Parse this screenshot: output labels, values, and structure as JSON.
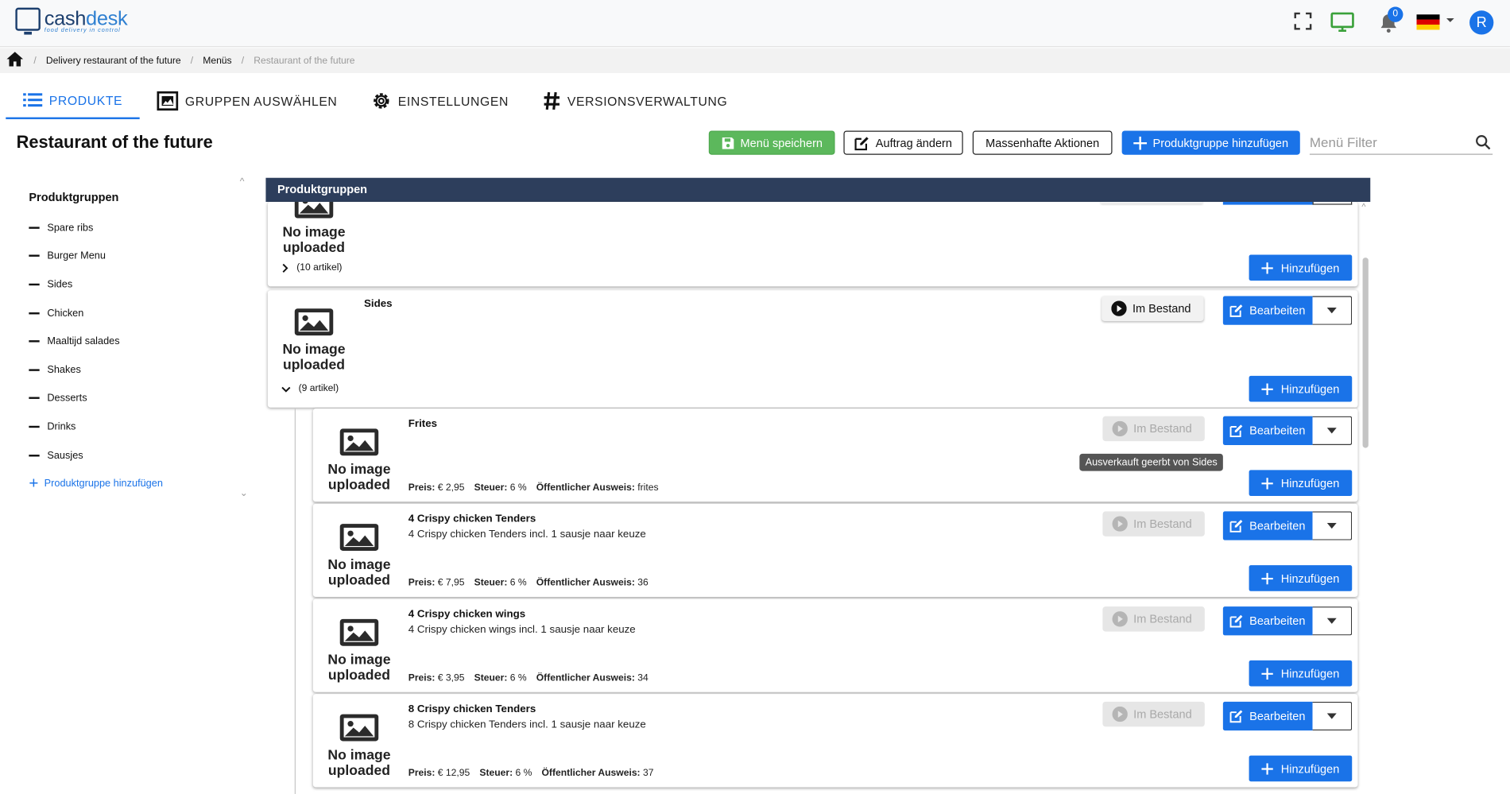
{
  "header": {
    "logo_name_part1": "cash",
    "logo_name_part2": "desk",
    "logo_tagline": "food delivery in control",
    "notification_count": "0",
    "avatar_initial": "R"
  },
  "breadcrumb": {
    "items": [
      "Delivery restaurant of the future",
      "Menüs"
    ],
    "current": "Restaurant of the future"
  },
  "tabs": [
    {
      "label": "PRODUKTE",
      "icon": "list-icon",
      "active": true
    },
    {
      "label": "GRUPPEN AUSWÄHLEN",
      "icon": "image-group-icon"
    },
    {
      "label": "EINSTELLUNGEN",
      "icon": "gear-icon"
    },
    {
      "label": "VERSIONSVERWALTUNG",
      "icon": "hash-icon"
    }
  ],
  "page_title": "Restaurant of the future",
  "toolbar": {
    "save_label": "Menü speichern",
    "change_order_label": "Auftrag ändern",
    "bulk_label": "Massenhafte Aktionen",
    "add_group_label": "Produktgruppe hinzufügen",
    "filter_placeholder": "Menü Filter"
  },
  "sidebar": {
    "title": "Produktgruppen",
    "items": [
      "Spare ribs",
      "Burger Menu",
      "Sides",
      "Chicken",
      "Maaltijd salades",
      "Shakes",
      "Desserts",
      "Drinks",
      "Sausjes"
    ],
    "add_label": "Produktgruppe hinzufügen"
  },
  "panel_title": "Produktgruppen",
  "no_image_line1": "No image",
  "no_image_line2": "uploaded",
  "groups": [
    {
      "name": "",
      "count": "(10 artikel)",
      "add_label": "Hinzufügen"
    },
    {
      "name": "Sides",
      "count": "(9 artikel)",
      "stock_label": "Im Bestand",
      "edit_label": "Bearbeiten",
      "add_label": "Hinzufügen"
    }
  ],
  "labels": {
    "price": "Preis:",
    "tax": "Steuer:",
    "public_id": "Öffentlicher Ausweis:",
    "stock": "Im Bestand",
    "edit": "Bearbeiten",
    "add": "Hinzufügen"
  },
  "products": [
    {
      "name": "Frites",
      "description": "",
      "price": "€ 2,95",
      "tax": "6 %",
      "public_id": "frites"
    },
    {
      "name": "4 Crispy chicken Tenders",
      "description": "4 Crispy chicken Tenders incl. 1 sausje naar keuze",
      "price": "€ 7,95",
      "tax": "6 %",
      "public_id": "36"
    },
    {
      "name": "4 Crispy chicken wings",
      "description": "4 Crispy chicken wings incl. 1 sausje naar keuze",
      "price": "€ 3,95",
      "tax": "6 %",
      "public_id": "34"
    },
    {
      "name": "8 Crispy chicken Tenders",
      "description": "8 Crispy chicken Tenders incl. 1 sausje naar keuze",
      "price": "€ 12,95",
      "tax": "6 %",
      "public_id": "37"
    }
  ],
  "tooltip": "Ausverkauft geerbt von Sides",
  "colors": {
    "primary": "#1a73e8",
    "success": "#5cb85c",
    "panel_header": "#2d3e5c"
  }
}
